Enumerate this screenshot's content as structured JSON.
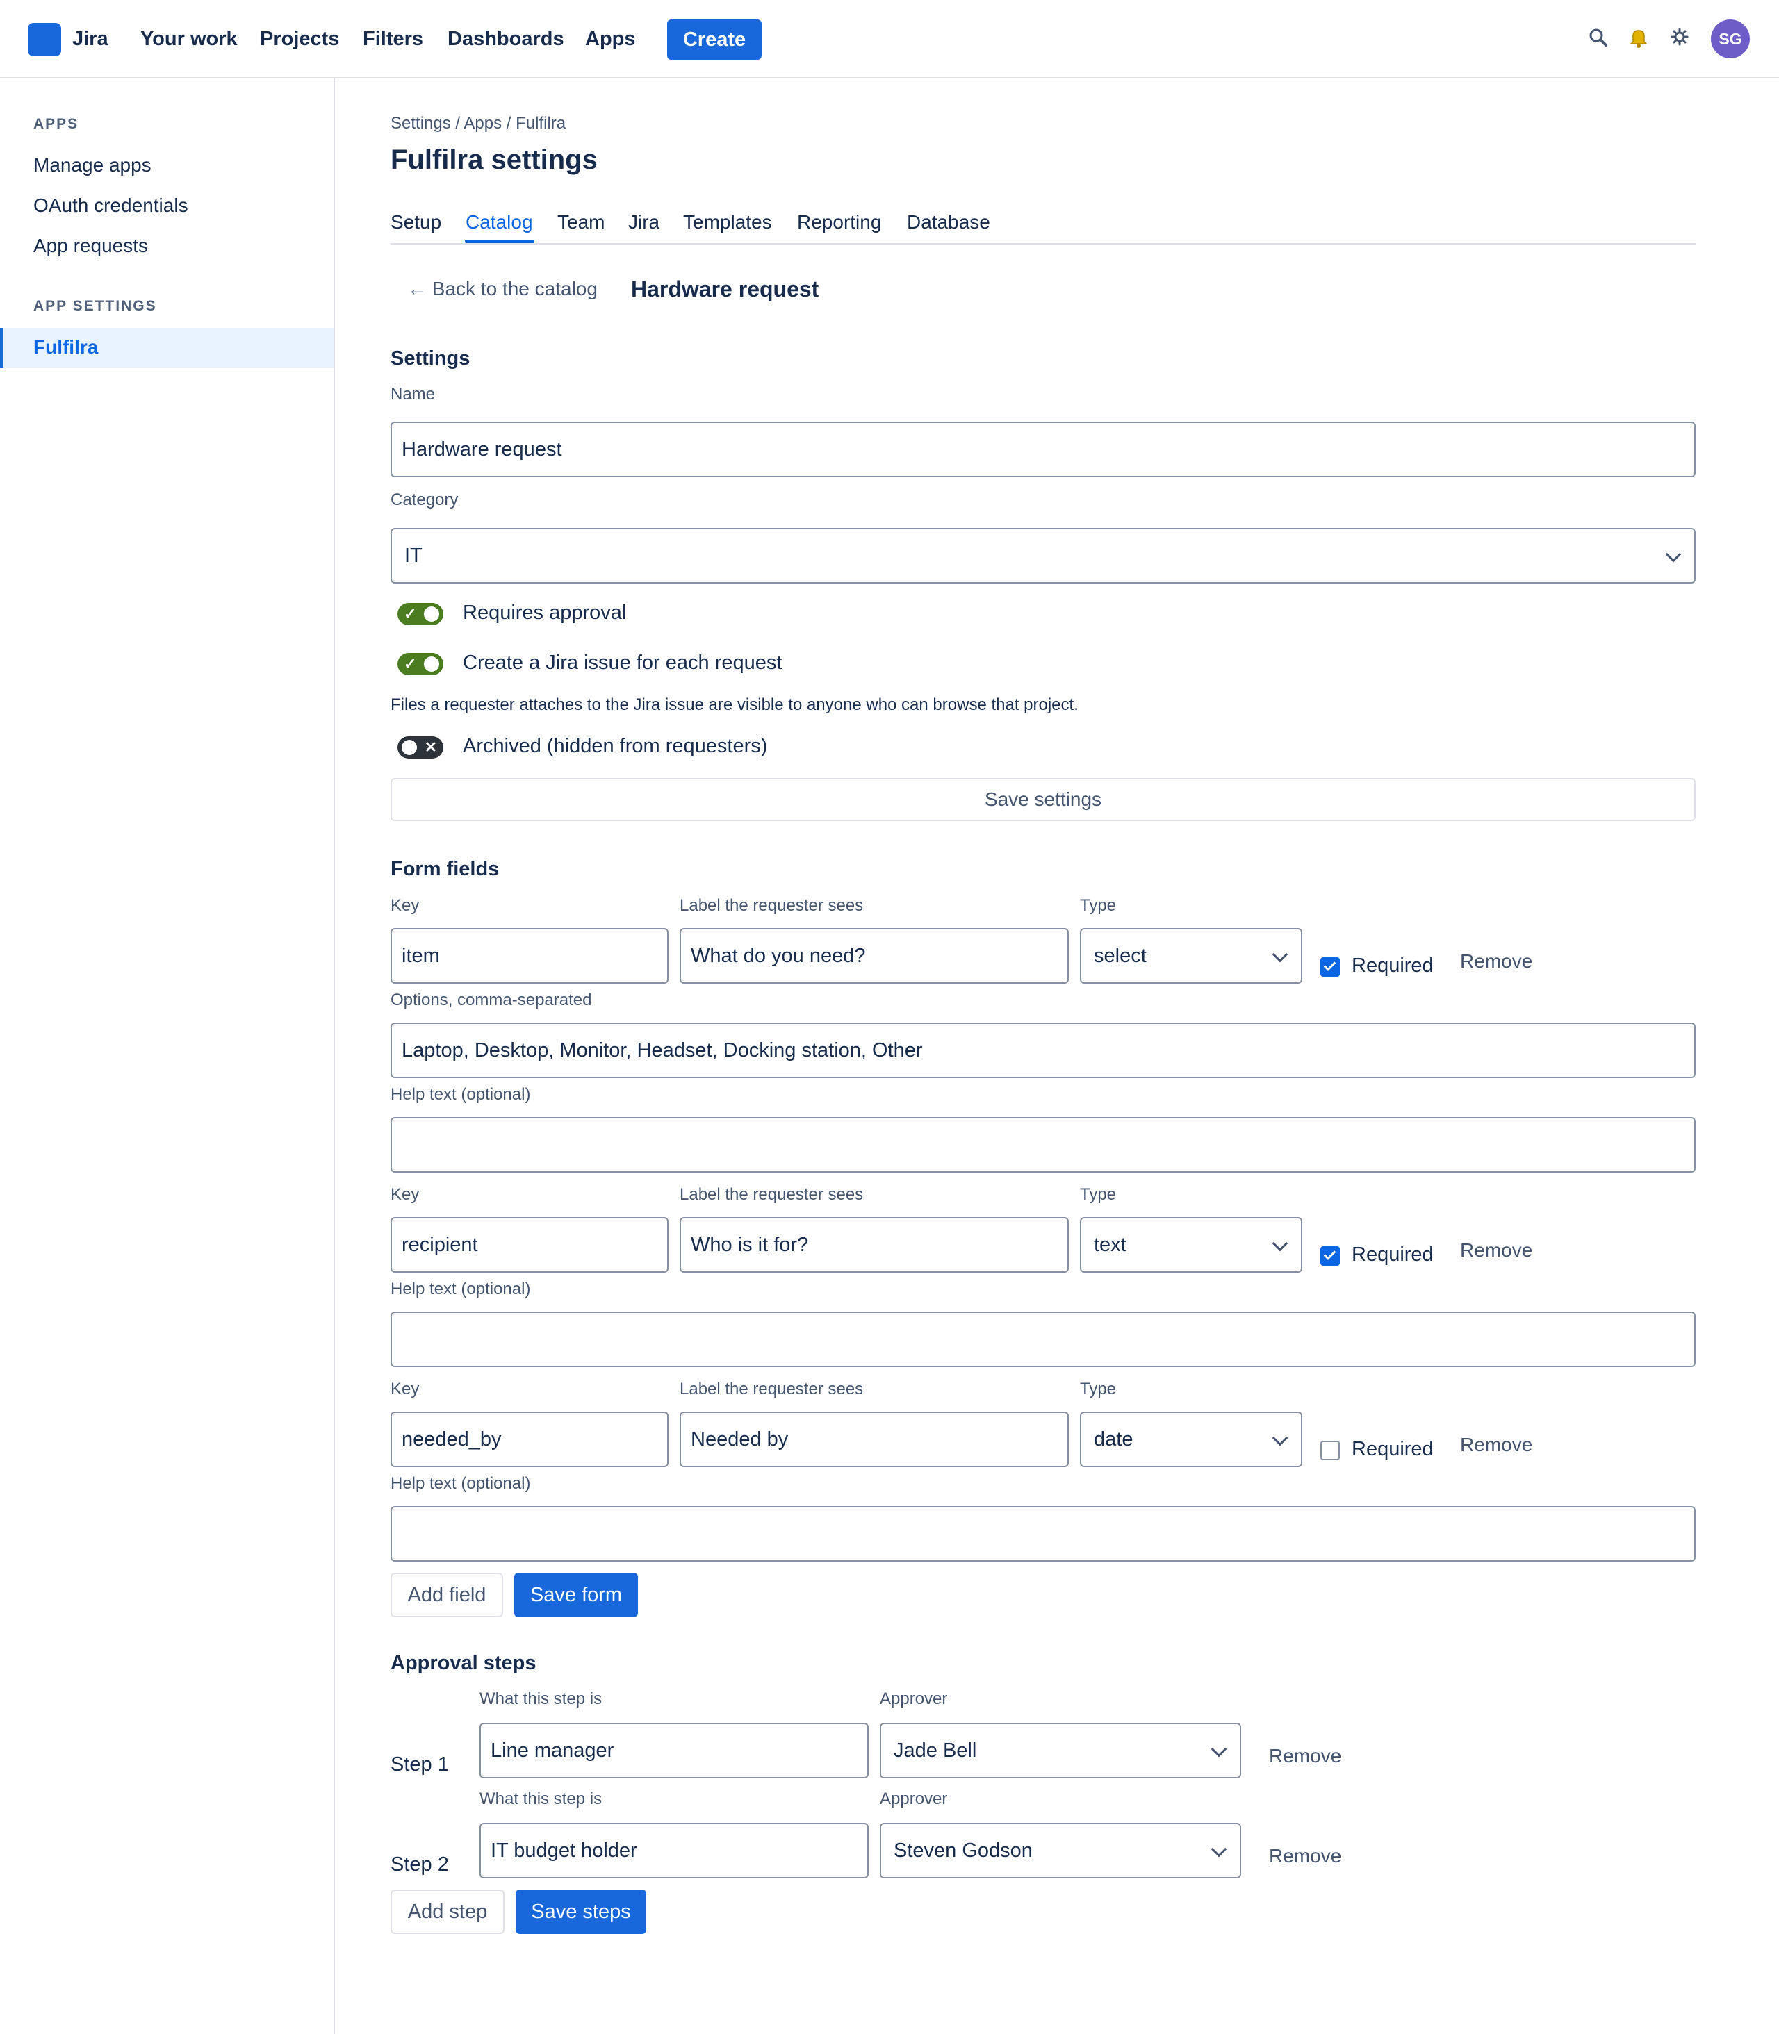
{
  "topnav": {
    "product": "Jira",
    "links": [
      "Your work",
      "Projects",
      "Filters",
      "Dashboards",
      "Apps"
    ],
    "create_label": "Create",
    "icons": [
      "search-icon",
      "bell-icon",
      "gear-icon"
    ],
    "avatar_initials": "SG"
  },
  "sidebar": {
    "apps_heading": "APPS",
    "apps_items": [
      "Manage apps",
      "OAuth credentials",
      "App requests"
    ],
    "settings_heading": "APP SETTINGS",
    "active_item": "Fulfilra"
  },
  "breadcrumb": [
    "Settings",
    "Apps",
    "Fulfilra"
  ],
  "breadcrumb_separator": "/",
  "page_title": "Fulfilra settings",
  "tabs": [
    "Setup",
    "Catalog",
    "Team",
    "Jira",
    "Templates",
    "Reporting",
    "Database"
  ],
  "active_tab": "Catalog",
  "back_link": "← Back to the catalog",
  "item_title": "Hardware request",
  "settings": {
    "heading": "Settings",
    "name_label": "Name",
    "name_value": "Hardware request",
    "category_label": "Category",
    "category_value": "IT",
    "requires_approval_label": "Requires approval",
    "requires_approval": true,
    "create_issue_label": "Create a Jira issue for each request",
    "create_issue": true,
    "visibility_note": "Files a requester attaches to the Jira issue are visible to anyone who can browse that project.",
    "archived_label": "Archived (hidden from requesters)",
    "archived": false,
    "save_label": "Save settings"
  },
  "form_fields": {
    "heading": "Form fields",
    "key_label": "Key",
    "label_label": "Label the requester sees",
    "type_label": "Type",
    "required_label": "Required",
    "remove_label": "Remove",
    "options_label": "Options, comma-separated",
    "help_label": "Help text (optional)",
    "fields": [
      {
        "key": "item",
        "label": "What do you need?",
        "type": "select",
        "required": true,
        "options": "Laptop, Desktop, Monitor, Headset, Docking station, Other",
        "help": ""
      },
      {
        "key": "recipient",
        "label": "Who is it for?",
        "type": "text",
        "required": true,
        "help": ""
      },
      {
        "key": "needed_by",
        "label": "Needed by",
        "type": "date",
        "required": false,
        "help": ""
      }
    ],
    "add_label": "Add field",
    "save_label": "Save form"
  },
  "approval_steps": {
    "heading": "Approval steps",
    "what_label": "What this step is",
    "approver_label": "Approver",
    "remove_label": "Remove",
    "steps": [
      {
        "label": "Step 1",
        "what": "Line manager",
        "approver": "Jade Bell"
      },
      {
        "label": "Step 2",
        "what": "IT budget holder",
        "approver": "Steven Godson"
      }
    ],
    "add_label": "Add step",
    "save_label": "Save steps"
  },
  "colors": {
    "brand": "#1868db",
    "toggle_on": "#4a7d1f",
    "toggle_off": "#2c333a",
    "avatar": "#6e5dc6",
    "active_bg": "#e9f2ff"
  }
}
